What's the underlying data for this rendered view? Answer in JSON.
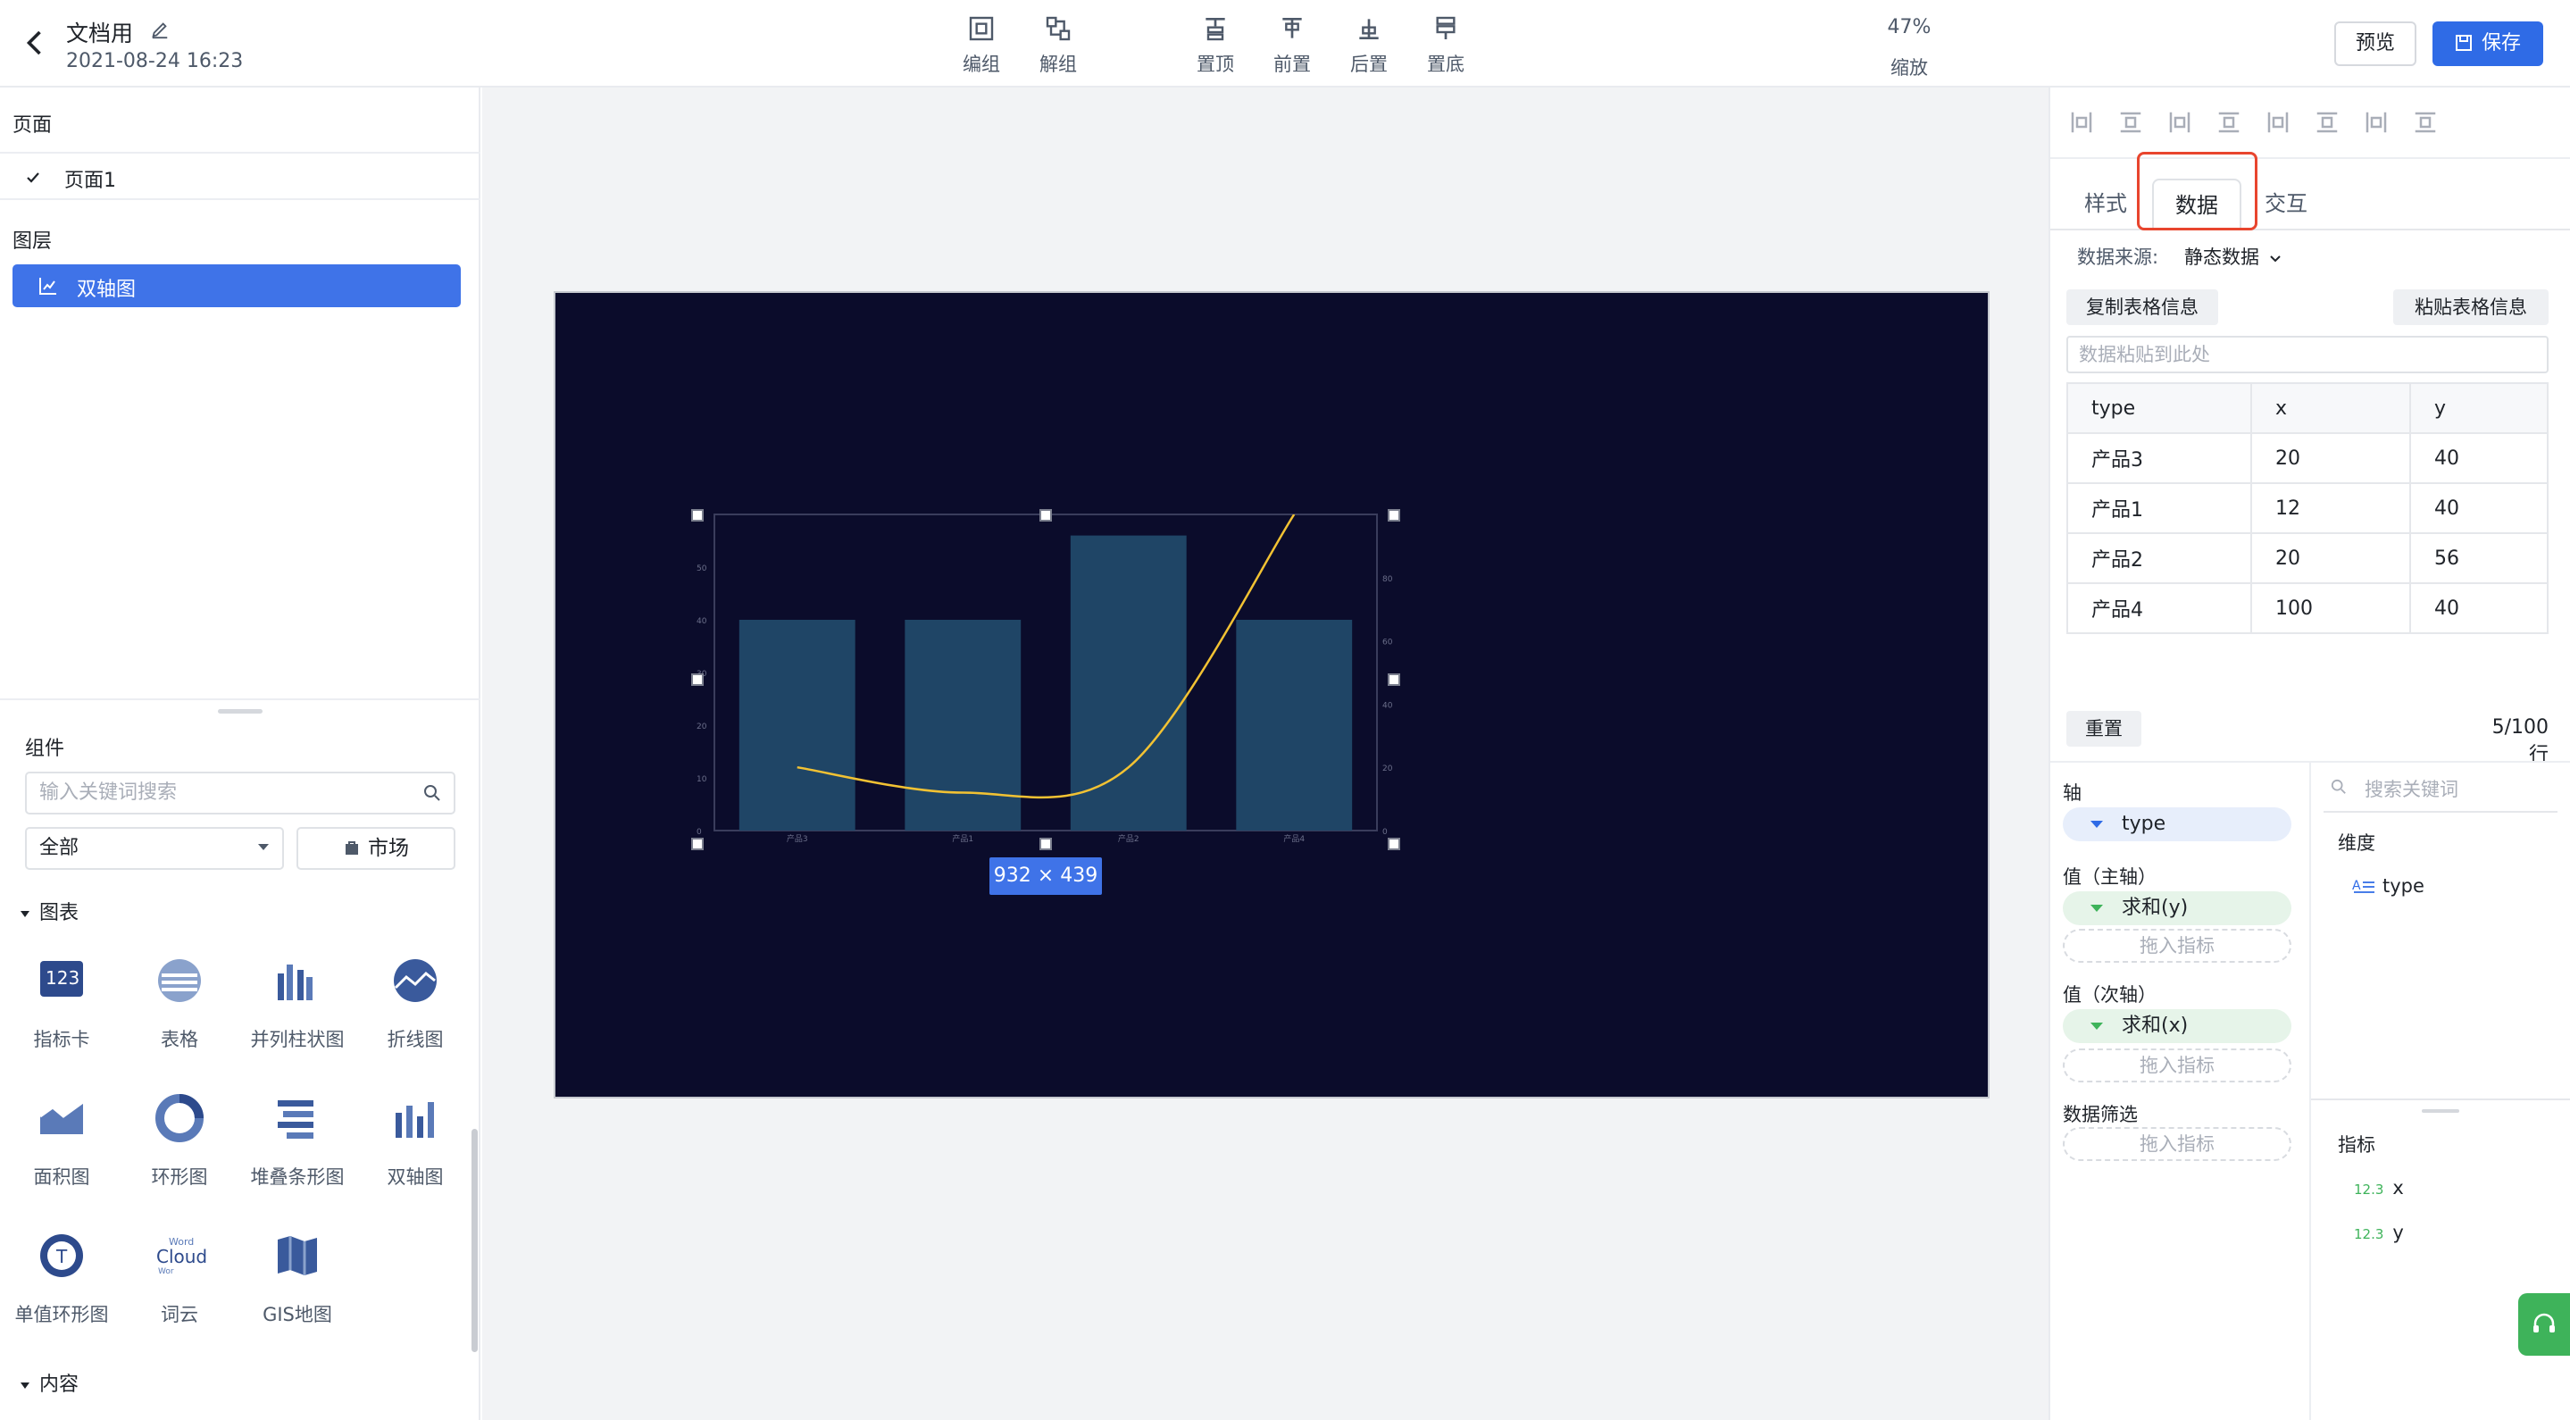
{
  "header": {
    "title": "文档用",
    "timestamp": "2021-08-24 16:23",
    "tools": [
      {
        "icon": "group-icon",
        "label": "编组"
      },
      {
        "icon": "ungroup-icon",
        "label": "解组"
      },
      {
        "icon": "bring-to-top-icon",
        "label": "置顶"
      },
      {
        "icon": "bring-forward-icon",
        "label": "前置"
      },
      {
        "icon": "send-backward-icon",
        "label": "后置"
      },
      {
        "icon": "send-to-bottom-icon",
        "label": "置底"
      }
    ],
    "zoom": "47%",
    "zoom_label": "缩放",
    "preview_label": "预览",
    "save_label": "保存"
  },
  "left": {
    "pages_label": "页面",
    "page_item": "页面1",
    "layers_label": "图层",
    "layer_item": "双轴图",
    "components_label": "组件",
    "search_placeholder": "输入关键词搜索",
    "filter_value": "全部",
    "market_label": "市场",
    "charts_group": "图表",
    "components": [
      {
        "icon": "metric-card-icon",
        "label": "指标卡"
      },
      {
        "icon": "table-icon",
        "label": "表格"
      },
      {
        "icon": "grouped-bar-icon",
        "label": "并列柱状图"
      },
      {
        "icon": "line-chart-icon",
        "label": "折线图"
      },
      {
        "icon": "area-chart-icon",
        "label": "面积图"
      },
      {
        "icon": "ring-chart-icon",
        "label": "环形图"
      },
      {
        "icon": "stacked-bar-icon",
        "label": "堆叠条形图"
      },
      {
        "icon": "dual-axis-icon",
        "label": "双轴图"
      },
      {
        "icon": "single-ring-icon",
        "label": "单值环形图"
      },
      {
        "icon": "word-cloud-icon",
        "label": "词云"
      },
      {
        "icon": "gis-map-icon",
        "label": "GIS地图"
      }
    ],
    "content_group": "内容"
  },
  "canvas": {
    "size_tag": "932 × 439",
    "stage_color": "#0b0c2b"
  },
  "chart_data": {
    "type": "bar",
    "categories": [
      "产品3",
      "产品1",
      "产品2",
      "产品4"
    ],
    "series": [
      {
        "name": "y",
        "type": "bar",
        "values": [
          40,
          40,
          56,
          40
        ],
        "axis": "primary"
      },
      {
        "name": "x",
        "type": "line",
        "values": [
          20,
          12,
          20,
          100
        ],
        "axis": "secondary"
      }
    ],
    "primary_ylim": [
      0,
      60
    ],
    "primary_ticks": [
      "0",
      "10",
      "20",
      "30",
      "40",
      "50"
    ],
    "secondary_ylim": [
      0,
      100
    ],
    "secondary_ticks": [
      "0",
      "20",
      "40",
      "60",
      "80"
    ],
    "bar_color": "#1f4566",
    "line_color": "#f2c233"
  },
  "right": {
    "tabs": [
      "样式",
      "数据",
      "交互"
    ],
    "active_tab": "数据",
    "source_label": "数据来源:",
    "source_value": "静态数据",
    "copy_label": "复制表格信息",
    "paste_label": "粘贴表格信息",
    "paste_placeholder": "数据粘贴到此处",
    "table_headers": [
      "type",
      "x",
      "y"
    ],
    "table_rows": [
      [
        "产品3",
        "20",
        "40"
      ],
      [
        "产品1",
        "12",
        "40"
      ],
      [
        "产品2",
        "20",
        "56"
      ],
      [
        "产品4",
        "100",
        "40"
      ]
    ],
    "reset_label": "重置",
    "row_count": "5/100 行",
    "axis_label": "轴",
    "axis_field": "type",
    "primary_label": "值（主轴）",
    "primary_field": "求和(y)",
    "secondary_label": "值（次轴）",
    "secondary_field": "求和(x)",
    "drop_hint": "拖入指标",
    "filter_label": "数据筛选",
    "field_search_placeholder": "搜索关键词",
    "dimension_label": "维度",
    "dimension_field": "type",
    "measure_label": "指标",
    "measure_fields": [
      "x",
      "y"
    ],
    "accent": "#2f6be6",
    "highlight": "#e8452e"
  }
}
